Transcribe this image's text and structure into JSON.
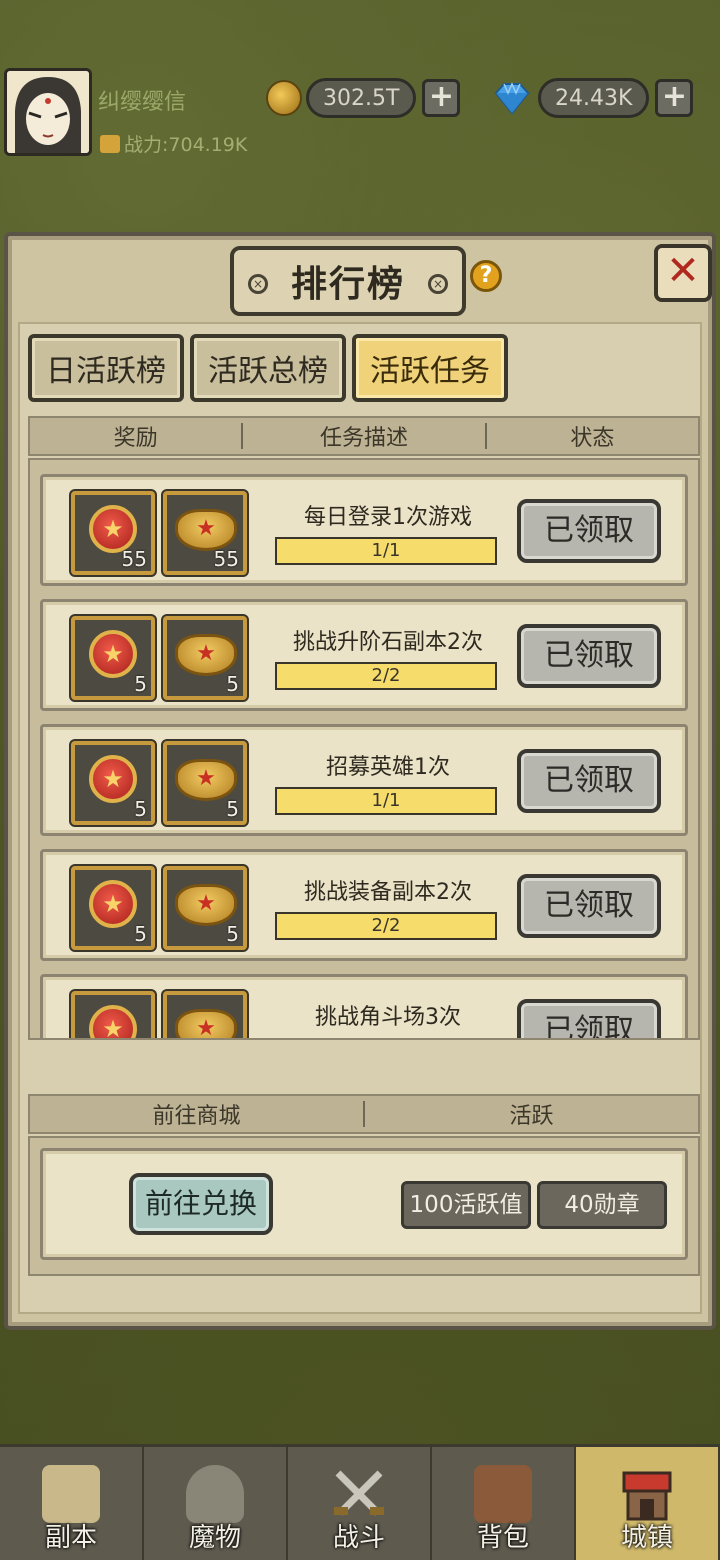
{
  "player": {
    "name": "纠缨缨信",
    "power": "战力:704.19K"
  },
  "currency": {
    "gold": "302.5T",
    "diamond": "24.43K",
    "plus": "+"
  },
  "modal": {
    "title": "排行榜",
    "help": "?",
    "close": "✕",
    "tabs": [
      "日活跃榜",
      "活跃总榜",
      "活跃任务"
    ],
    "active_tab": "活跃任务",
    "columns": [
      "奖励",
      "任务描述",
      "状态"
    ],
    "tasks": [
      {
        "desc": "每日登录1次游戏",
        "progress": "1/1",
        "reward1": "55",
        "reward2": "55",
        "status": "已领取"
      },
      {
        "desc": "挑战升阶石副本2次",
        "progress": "2/2",
        "reward1": "5",
        "reward2": "5",
        "status": "已领取"
      },
      {
        "desc": "招募英雄1次",
        "progress": "1/1",
        "reward1": "5",
        "reward2": "5",
        "status": "已领取"
      },
      {
        "desc": "挑战装备副本2次",
        "progress": "2/2",
        "reward1": "5",
        "reward2": "5",
        "status": "已领取"
      },
      {
        "desc": "挑战角斗场3次",
        "progress": "",
        "reward1": "",
        "reward2": "",
        "status": "已领取"
      }
    ],
    "bottom_columns": [
      "前往商城",
      "活跃"
    ],
    "exchange_button": "前往兑换",
    "activity_value": "100活跃值",
    "medals": "40勋章"
  },
  "nav": [
    "副本",
    "魔物",
    "战斗",
    "背包",
    "城镇"
  ],
  "nav_active": "城镇",
  "colors": {
    "progress_fill": "#f6dc6a",
    "active_tab": "#f0d27a",
    "close_x": "#b0281e"
  }
}
